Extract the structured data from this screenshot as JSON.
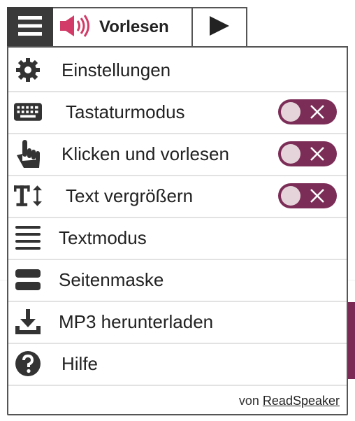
{
  "toolbar": {
    "menu_icon": "hamburger-icon",
    "listen_icon": "speaker-icon",
    "listen_label": "Vorlesen",
    "play_icon": "play-icon"
  },
  "menu": {
    "items": [
      {
        "label": "Einstellungen",
        "icon": "gear-icon"
      },
      {
        "label": "Tastaturmodus",
        "icon": "keyboard-icon",
        "toggle": "off"
      },
      {
        "label": "Klicken und vorlesen",
        "icon": "pointer-hand-icon",
        "toggle": "off"
      },
      {
        "label": "Text vergrößern",
        "icon": "text-size-icon",
        "toggle": "off"
      },
      {
        "label": "Textmodus",
        "icon": "text-lines-icon"
      },
      {
        "label": "Seitenmaske",
        "icon": "page-mask-icon"
      },
      {
        "label": "MP3 herunterladen",
        "icon": "download-icon"
      },
      {
        "label": "Hilfe",
        "icon": "help-icon"
      }
    ],
    "footer_prefix": "von",
    "footer_link": "ReadSpeaker"
  },
  "colors": {
    "toggle_bg": "#7c2d57",
    "speaker": "#d23a67",
    "menu_button_bg": "#3a3a3a"
  }
}
